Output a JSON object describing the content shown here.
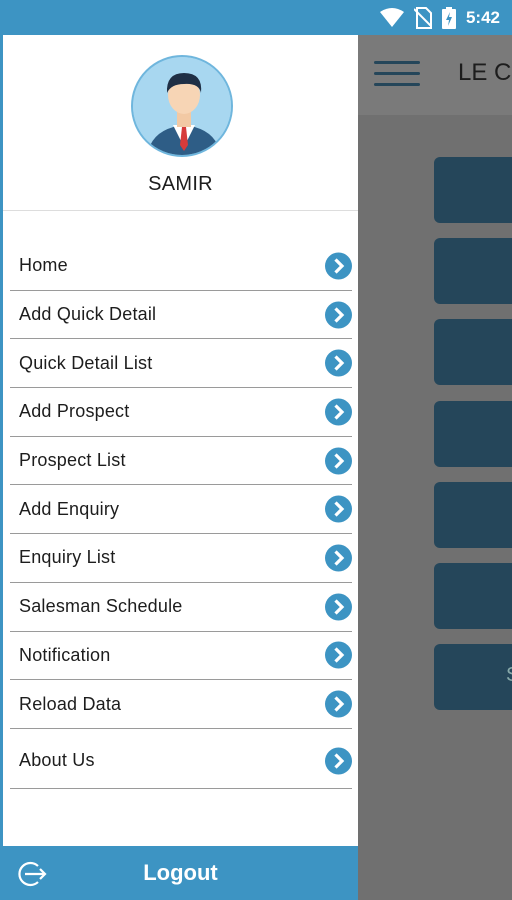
{
  "status_bar": {
    "time": "5:42",
    "icons": [
      "wifi-icon",
      "no-sim-icon",
      "battery-charging-icon"
    ]
  },
  "background_app": {
    "title": "LE C",
    "tile_suffix": "S"
  },
  "drawer": {
    "profile": {
      "username": "SAMIR"
    },
    "menu": {
      "items": [
        {
          "label": "Home"
        },
        {
          "label": "Add Quick Detail"
        },
        {
          "label": "Quick Detail List"
        },
        {
          "label": "Add Prospect"
        },
        {
          "label": "Prospect List"
        },
        {
          "label": "Add Enquiry"
        },
        {
          "label": "Enquiry List"
        },
        {
          "label": "Salesman Schedule"
        },
        {
          "label": "Notification"
        },
        {
          "label": "Reload Data"
        },
        {
          "label": "About Us"
        }
      ]
    },
    "logout_label": "Logout"
  },
  "colors": {
    "accent": "#3d94c3",
    "dark_tile": "#25465a",
    "text": "#1d1d1d"
  }
}
